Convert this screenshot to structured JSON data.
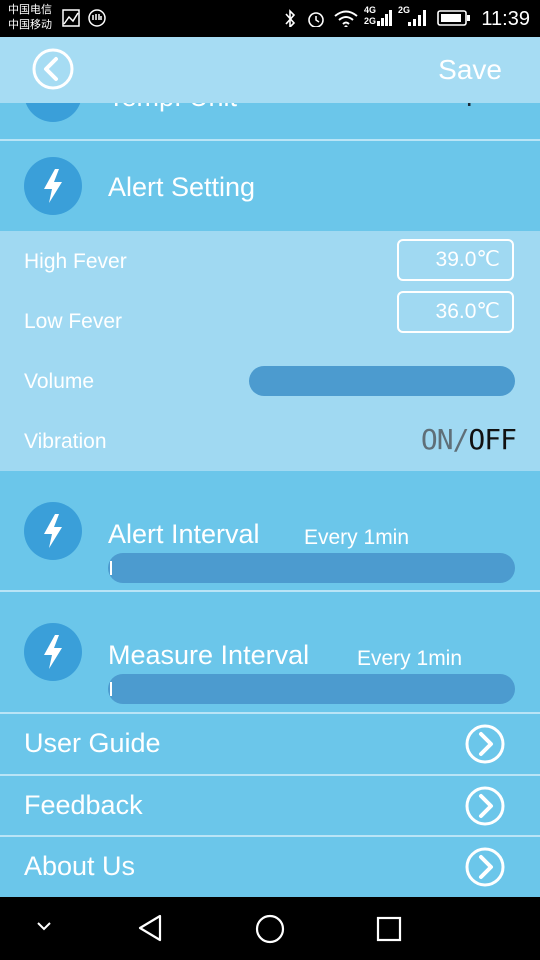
{
  "status_bar": {
    "carrier_1": "中国电信",
    "carrier_2": "中国移动",
    "net_1": "4G",
    "net_2": "2G",
    "net_3": "2G",
    "time": "11:39"
  },
  "header": {
    "save_label": "Save"
  },
  "partial_row": {
    "label": "Temp. Unit",
    "value": "°F"
  },
  "alert_setting": {
    "title": "Alert Setting",
    "high_fever_label": "High Fever",
    "high_fever_value": "39.0℃",
    "low_fever_label": "Low Fever",
    "low_fever_value": "36.0℃",
    "volume_label": "Volume",
    "volume_level": 0.0,
    "vibration_label": "Vibration",
    "vibration_on": "ON",
    "vibration_separator": "/",
    "vibration_off": "OFF"
  },
  "alert_interval": {
    "title": "Alert Interval",
    "value_text": "Every 1min",
    "slider_level": 0.0
  },
  "measure_interval": {
    "title": "Measure Interval",
    "value_text": "Every 1min",
    "slider_level": 0.0
  },
  "menu": [
    {
      "label": "User Guide"
    },
    {
      "label": "Feedback"
    },
    {
      "label": "About Us"
    }
  ],
  "colors": {
    "background": "#6bc6ea",
    "header": "#a6dcf3",
    "panel_light": "#a0d9f2",
    "icon_circle": "#3a9fd9",
    "slider": "#4c9bcf"
  },
  "icons": [
    "back-chevron-icon",
    "lightning-icon",
    "chevron-right-icon",
    "nav-back-icon",
    "nav-home-icon",
    "nav-recents-icon"
  ]
}
